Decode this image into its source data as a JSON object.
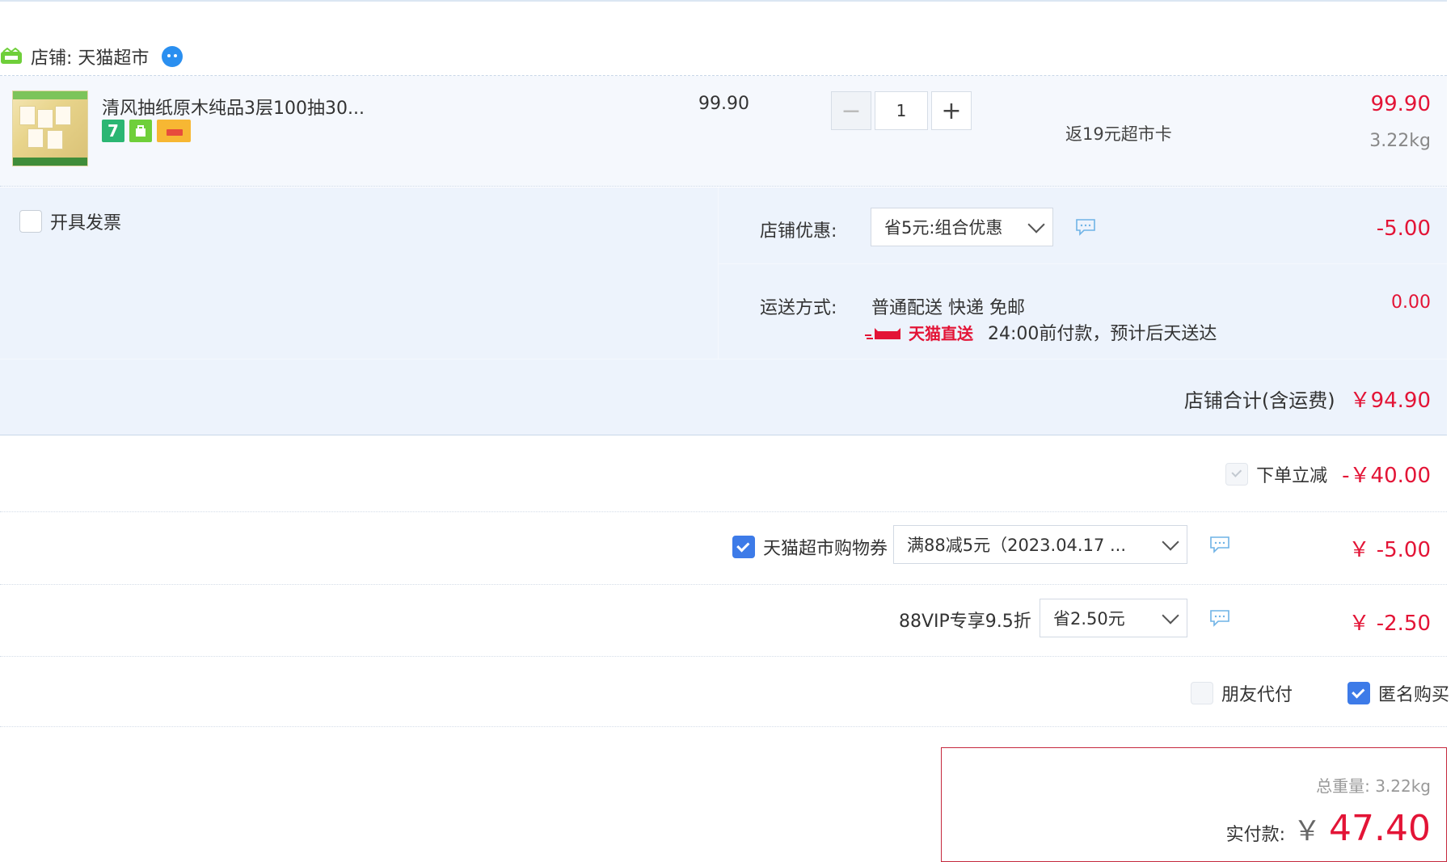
{
  "shop": {
    "label": "店铺: 天猫超市"
  },
  "product": {
    "title": "清风抽纸原木纯品3层100抽30...",
    "unit_price": "99.90",
    "quantity": "1",
    "cashback": "返19元超市卡",
    "line_total": "99.90",
    "weight": "3.22kg"
  },
  "invoice": {
    "label": "开具发票",
    "checked": false
  },
  "shop_discount": {
    "label": "店铺优惠:",
    "selected": "省5元:组合优惠",
    "amount": "-5.00"
  },
  "shipping": {
    "label": "运送方式:",
    "method": "普通配送 快递 免邮",
    "brand": "天猫直送",
    "note": "24:00前付款，预计后天送达",
    "amount": "0.00"
  },
  "shop_total": {
    "label": "店铺合计(含运费)",
    "amount": "￥94.90"
  },
  "instant_discount": {
    "label": "下单立减",
    "amount": "-￥40.00"
  },
  "coupon": {
    "label": "天猫超市购物券",
    "selected": "满88减5元（2023.04.17 ...",
    "amount": "￥ -5.00",
    "checked": true
  },
  "vip": {
    "label": "88VIP专享9.5折",
    "selected": "省2.50元",
    "amount": "￥ -2.50"
  },
  "options": {
    "friend_pay": "朋友代付",
    "anonymous": "匿名购买",
    "anonymous_checked": true
  },
  "summary": {
    "total_weight": "总重量: 3.22kg",
    "pay_label": "实付款:",
    "currency": "￥",
    "pay_amount": "47.40"
  },
  "colors": {
    "accent_red": "#e31436",
    "accent_blue": "#3d7be8"
  }
}
